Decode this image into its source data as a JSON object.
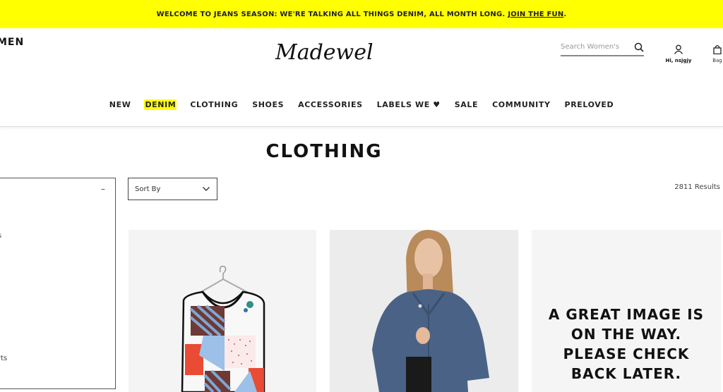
{
  "promo": {
    "message": "WELCOME TO JEANS SEASON: WE'RE TALKING ALL THINGS DENIM, ALL MONTH LONG.",
    "link": "JOIN THE FUN",
    "trailing": ".",
    "color": "#ffff00"
  },
  "header": {
    "department": "MEN",
    "logo_text": "Madewell",
    "search": {
      "placeholder": "Search Women's",
      "value": ""
    },
    "account_label": "Hi, nsjgjy",
    "bag_label": "Bag"
  },
  "nav": {
    "items": [
      {
        "label": "NEW",
        "active": false
      },
      {
        "label": "DENIM",
        "active": true
      },
      {
        "label": "CLOTHING",
        "active": false
      },
      {
        "label": "SHOES",
        "active": false
      },
      {
        "label": "ACCESSORIES",
        "active": false
      },
      {
        "label": "LABELS WE ♥",
        "active": false
      },
      {
        "label": "SALE",
        "active": false
      },
      {
        "label": "COMMUNITY",
        "active": false
      },
      {
        "label": "PRELOVED",
        "active": false
      }
    ]
  },
  "page": {
    "title": "CLOTHING",
    "filter_toggle": "–",
    "filter_partial_1": "s",
    "filter_partial_2": "rts",
    "sort_label": "Sort By",
    "results": "2811 Results"
  },
  "products": [
    {
      "image": "patchwork-sleeveless-top-on-hanger"
    },
    {
      "image": "model-in-denim-jacket"
    },
    {
      "image": "placeholder",
      "placeholder_text": [
        "A GREAT IMAGE IS",
        "ON THE WAY.",
        "PLEASE CHECK",
        "BACK LATER."
      ]
    }
  ]
}
